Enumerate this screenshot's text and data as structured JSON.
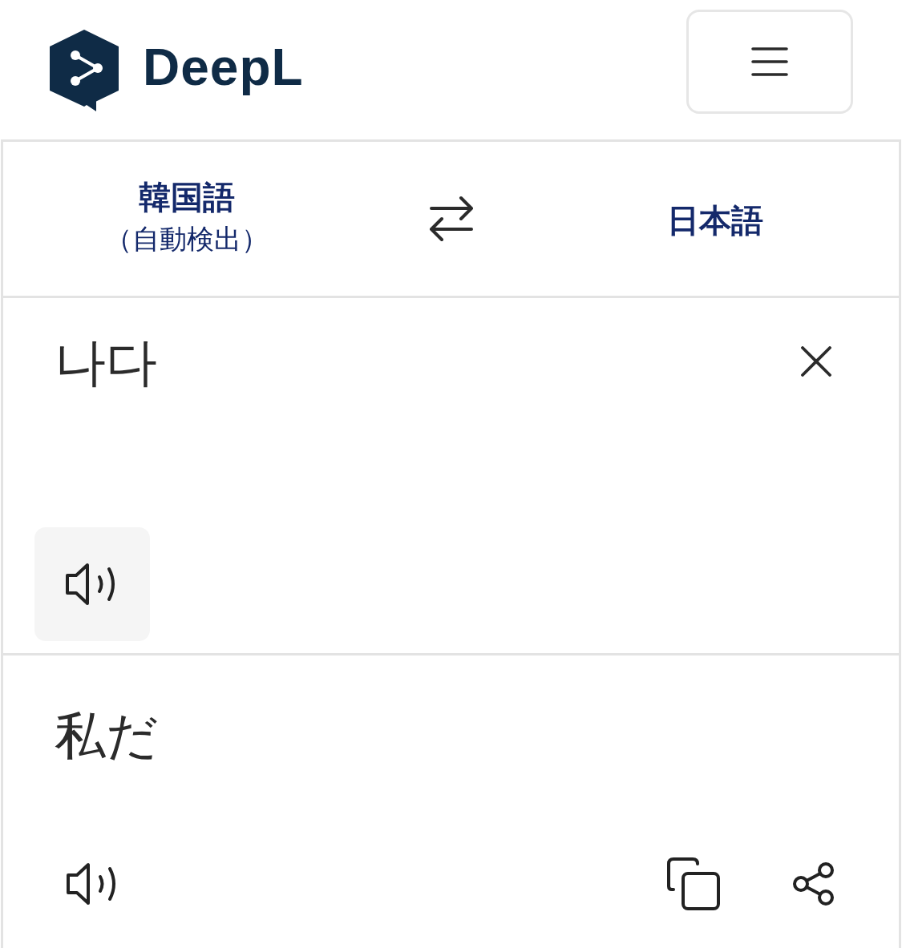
{
  "header": {
    "logo_text": "DeepL"
  },
  "language_bar": {
    "source": {
      "name": "韓国語",
      "note": "（自動検出）"
    },
    "target": {
      "name": "日本語"
    }
  },
  "input": {
    "text": "나다"
  },
  "output": {
    "text": "私だ"
  }
}
